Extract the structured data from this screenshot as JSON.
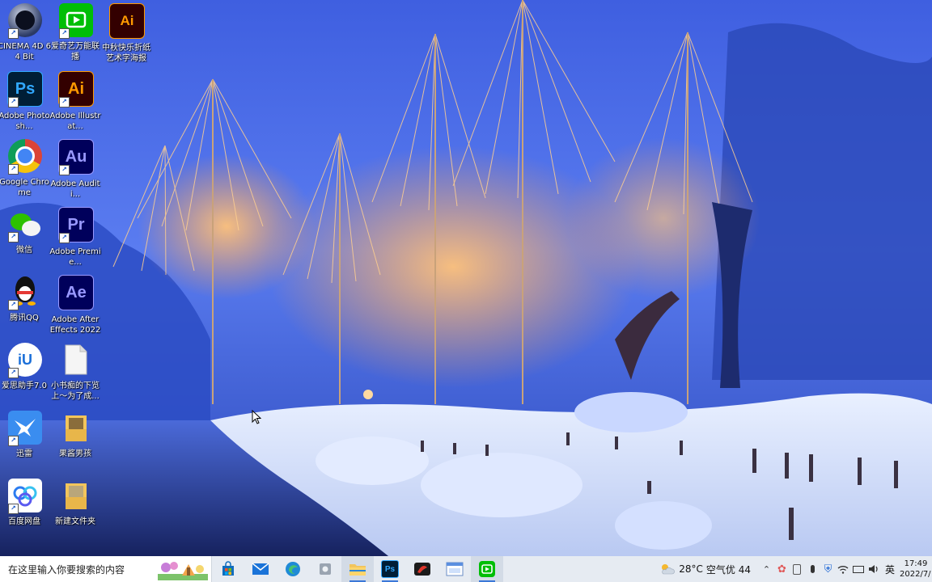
{
  "desktop": {
    "icons_col1": [
      {
        "label": "CINEMA 4D 64 Bit",
        "icon": "cinema4d-icon",
        "shortcut": true
      },
      {
        "label": "Adobe Photosh...",
        "icon": "photoshop-icon",
        "glyph": "Ps",
        "shortcut": true
      },
      {
        "label": "Google Chrome",
        "icon": "chrome-icon",
        "shortcut": true
      },
      {
        "label": "微信",
        "icon": "wechat-icon",
        "shortcut": true
      },
      {
        "label": "腾讯QQ",
        "icon": "qq-icon",
        "shortcut": true
      },
      {
        "label": "爱思助手7.0",
        "icon": "i4-assistant-icon",
        "glyph": "iU",
        "shortcut": true
      },
      {
        "label": "迅雷",
        "icon": "thunder-icon",
        "shortcut": true
      },
      {
        "label": "百度网盘",
        "icon": "baidu-netdisk-icon",
        "shortcut": true
      }
    ],
    "icons_col2": [
      {
        "label": "爱奇艺万能联播",
        "icon": "iqiyi-icon",
        "shortcut": true
      },
      {
        "label": "Adobe Illustrat...",
        "icon": "illustrator-icon",
        "glyph": "Ai",
        "shortcut": true
      },
      {
        "label": "Adobe Auditi...",
        "icon": "audition-icon",
        "glyph": "Au",
        "shortcut": true
      },
      {
        "label": "Adobe Premie...",
        "icon": "premiere-icon",
        "glyph": "Pr",
        "shortcut": true
      },
      {
        "label": "Adobe After Effects 2022",
        "icon": "after-effects-icon",
        "glyph": "Ae",
        "shortcut": false
      },
      {
        "label": "小书痴的下览上～为了成...",
        "icon": "text-file-icon",
        "shortcut": false
      },
      {
        "label": "果酱男孩",
        "icon": "folder-icon",
        "shortcut": false
      },
      {
        "label": "新建文件夹",
        "icon": "folder-icon",
        "shortcut": false
      }
    ],
    "icons_col3": [
      {
        "label": "中秋快乐折纸艺术字海报",
        "icon": "ai-file-icon",
        "glyph": "Ai",
        "shortcut": false
      }
    ],
    "shortcut_arrow": "↗"
  },
  "taskbar": {
    "search_placeholder": "在这里输入你要搜索的内容",
    "apps": [
      {
        "name": "store-icon",
        "active": false
      },
      {
        "name": "mail-icon",
        "active": false
      },
      {
        "name": "edge-icon",
        "active": false
      },
      {
        "name": "app-settings-icon",
        "active": false
      },
      {
        "name": "file-explorer-icon",
        "active": true
      },
      {
        "name": "photoshop-taskbar-icon",
        "glyph": "Ps",
        "active": true
      },
      {
        "name": "red-app-icon",
        "active": false
      },
      {
        "name": "window-app-icon",
        "active": false
      },
      {
        "name": "iqiyi-taskbar-icon",
        "active": true
      }
    ],
    "tray": {
      "temperature": "28°C",
      "air_quality": "空气优 44",
      "language": "英",
      "time": "17:49",
      "date": "2022/7/"
    }
  },
  "colors": {
    "ps": "#31a8ff",
    "ps_bg": "#001e36",
    "ai": "#ff9a00",
    "ai_bg": "#330000",
    "au": "#9999ff",
    "au_bg": "#00005b",
    "pr": "#9999ff",
    "pr_bg": "#00005b",
    "ae": "#9999ff",
    "ae_bg": "#00005b"
  }
}
